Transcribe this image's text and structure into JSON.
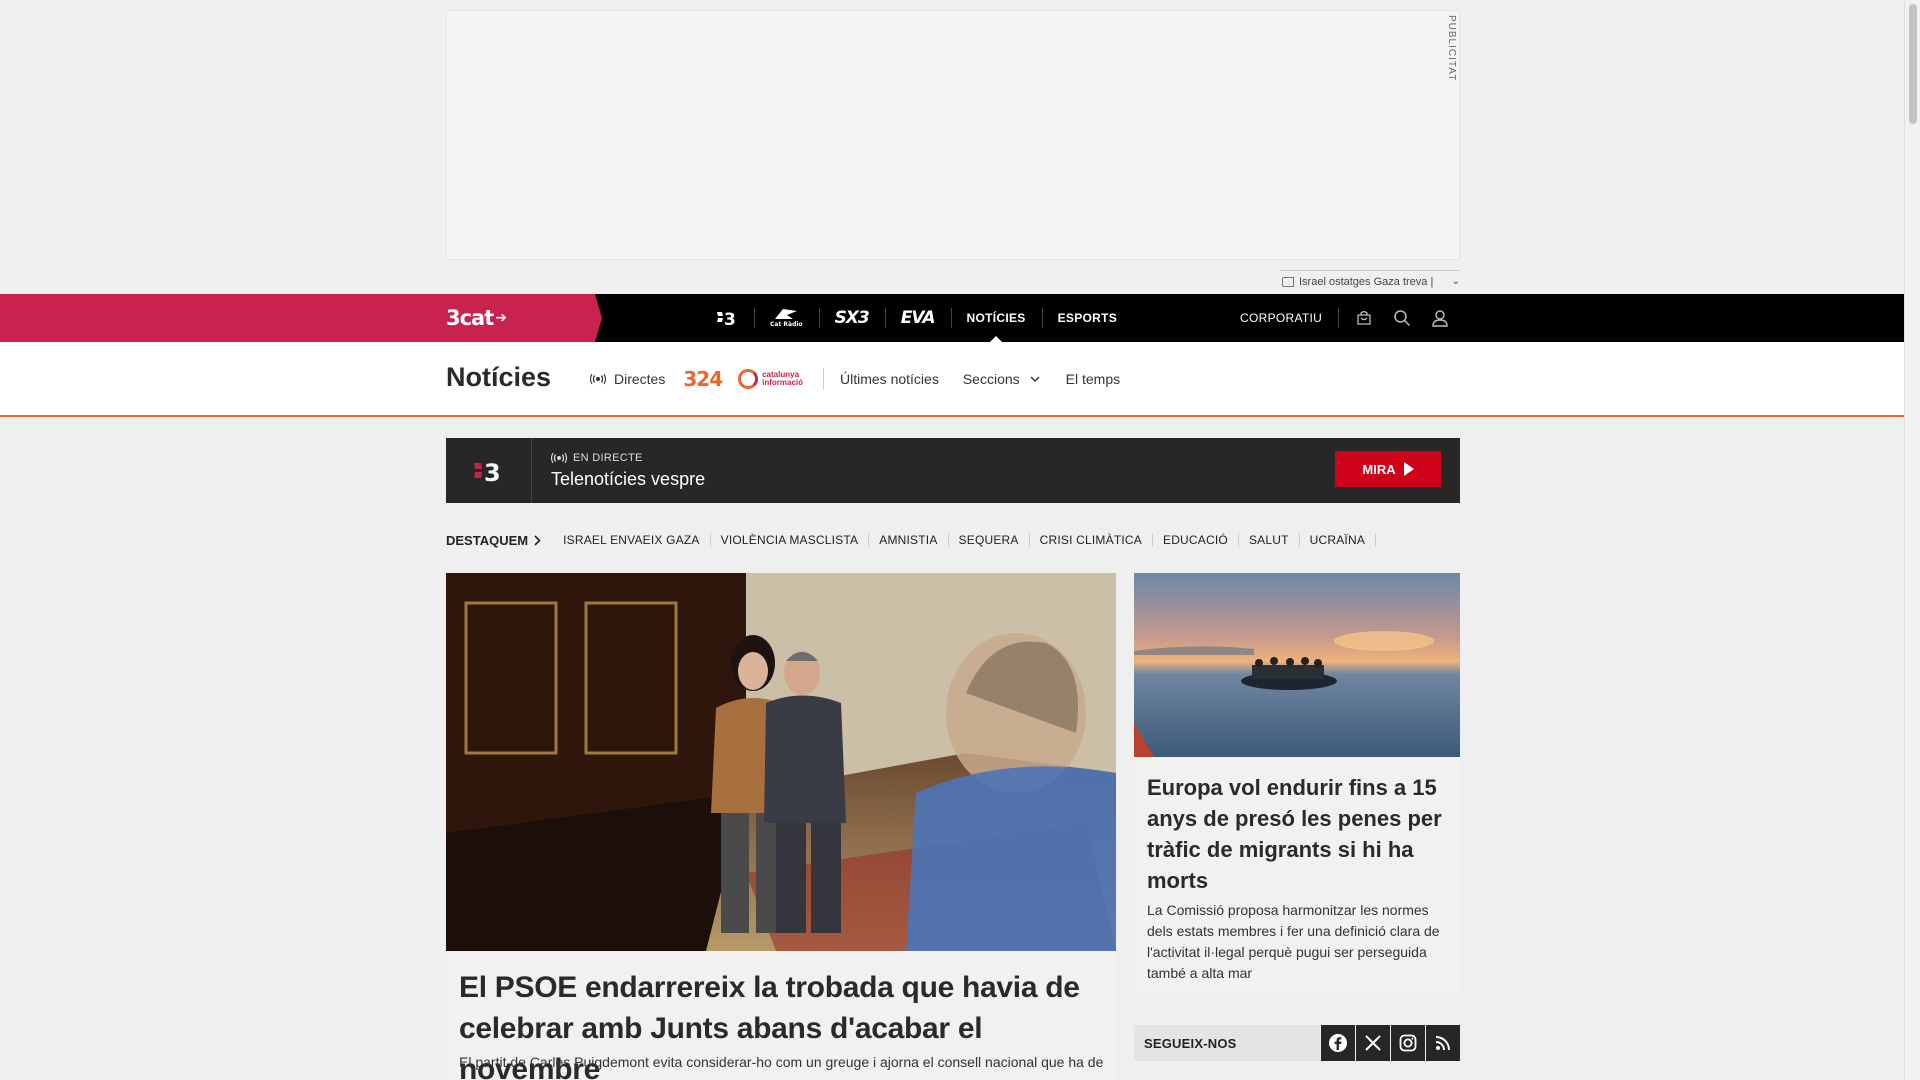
{
  "ad": {
    "label": "PUBLICITAT"
  },
  "hot_topic": {
    "text": "Israel ostatges Gaza treva |"
  },
  "topbar": {
    "logo": "3cat",
    "channels": [
      {
        "label": "3",
        "icon": "tv3-logo"
      },
      {
        "label": "Cat Ràdio",
        "icon": "catradio-logo"
      },
      {
        "label": "SX3",
        "icon": "sx3-logo"
      },
      {
        "label": "EVA",
        "icon": "eva-logo"
      },
      {
        "label": "NOTÍCIES",
        "active": true
      },
      {
        "label": "ESPORTS"
      }
    ],
    "corporatiu": "CORPORATIU"
  },
  "section": {
    "title": "Notícies",
    "directes": "Directes",
    "logo_324": "324",
    "logo_catinfo_line1": "catalunya",
    "logo_catinfo_line2": "informació",
    "nav": [
      "Últimes notícies",
      "Seccions",
      "El temps"
    ]
  },
  "live": {
    "channel": "3",
    "label": "EN DIRECTE",
    "title": "Telenotícies vespre",
    "button": "MIRA"
  },
  "destaquem": {
    "head": "DESTAQUEM",
    "topics": [
      "ISRAEL ENVAEIX GAZA",
      "VIOLÈNCIA MASCLISTA",
      "AMNISTIA",
      "SEQUERA",
      "CRISI CLIMÀTICA",
      "EDUCACIÓ",
      "SALUT",
      "UCRAÏNA"
    ]
  },
  "main_article": {
    "title": "El PSOE endarrereix la trobada que havia de celebrar amb Junts abans d'acabar el novembre",
    "summary": "El partit de Carles Puigdemont evita considerar-ho com un greuge i ajorna el consell nacional que ha de"
  },
  "side_article": {
    "title": "Europa vol endurir fins a 15 anys de presó les penes per tràfic de migrants si hi ha morts",
    "summary": "La Comissió proposa harmonitzar les normes dels estats membres i fer una definició clara de l'activitat il·legal perquè pugui ser perseguida també a alta mar"
  },
  "social": {
    "label": "SEGUEIX-NOS",
    "networks": [
      "facebook-icon",
      "x-icon",
      "instagram-icon",
      "rss-icon"
    ]
  },
  "colors": {
    "brand_red": "#c8224f",
    "accent_orange": "#e8672a",
    "live_red": "#d0021b",
    "topbar_black": "#000000"
  }
}
